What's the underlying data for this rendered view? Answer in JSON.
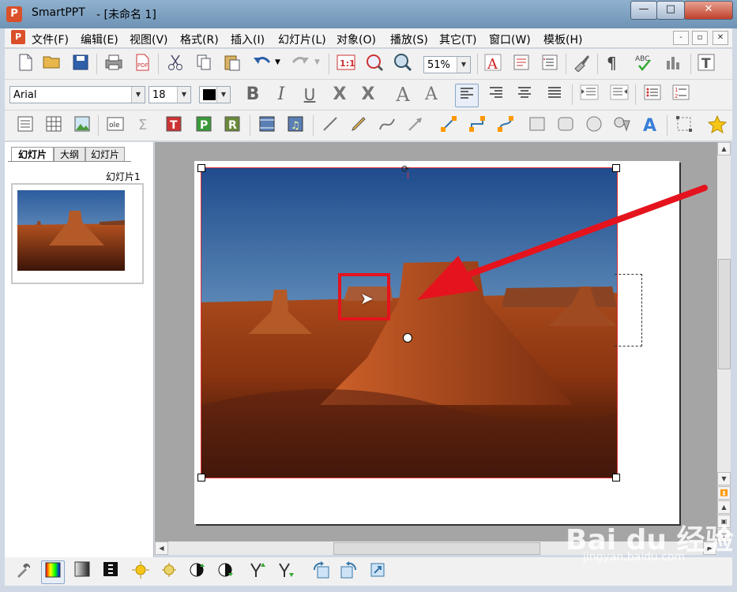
{
  "window": {
    "app_name": "SmartPPT",
    "doc_title": "- [未命名 1]",
    "app_icon_letter": "P",
    "minimize": "—",
    "maximize": "□",
    "close": "✕"
  },
  "menu": {
    "items": [
      "文件(F)",
      "编辑(E)",
      "视图(V)",
      "格式(R)",
      "插入(I)",
      "幻灯片(L)",
      "对象(O)",
      "播放(S)",
      "其它(T)",
      "窗口(W)",
      "模板(H)"
    ],
    "mdi_buttons": [
      "-",
      "▫",
      "✕"
    ]
  },
  "toolbar_standard": {
    "zoom": "51%",
    "icons": [
      "new-icon",
      "open-icon",
      "save-icon",
      "print-icon",
      "pdf-icon",
      "cut-icon",
      "copy-icon",
      "paste-icon",
      "undo-icon",
      "redo-icon",
      "actual-size-icon",
      "zoom-fit-icon",
      "zoom-icon",
      "font-color-icon",
      "format-icon",
      "list-icon",
      "brush-icon",
      "paragraph-icon",
      "spellcheck-icon",
      "chart-icon",
      "text-frame-icon"
    ]
  },
  "toolbar_format": {
    "font_name": "Arial",
    "font_size": "18",
    "color": "#000000",
    "bold": "B",
    "italic": "I",
    "underline": "U",
    "strike": "X",
    "strike2": "X",
    "grow": "A",
    "shrink": "A"
  },
  "toolbar_draw": {
    "icons": [
      "text-box-icon",
      "table-icon",
      "image-icon",
      "ole-icon",
      "formula-icon",
      "text-t-icon",
      "text-p-icon",
      "text-r-icon",
      "video-icon",
      "audio-icon",
      "line-icon",
      "pencil-icon",
      "curve-icon",
      "arrow-icon",
      "connector1-icon",
      "connector2-icon",
      "connector3-icon",
      "rectangle-icon",
      "rounded-rect-icon",
      "ellipse-icon",
      "shape-icon",
      "wordart-icon",
      "group-icon",
      "star-icon"
    ]
  },
  "left_panel": {
    "tabs": [
      "幻灯片",
      "大纲",
      "幻灯片"
    ],
    "thumb_label": "幻灯片1"
  },
  "bottom_toolbar": {
    "icons": [
      "tool-icon",
      "color-icon",
      "gradient-icon",
      "bw-icon",
      "brightness-up-icon",
      "brightness-down-icon",
      "contrast-up-icon",
      "contrast-down-icon",
      "gamma-up-icon",
      "gamma-down-icon",
      "rotate-left-icon",
      "rotate-right-icon",
      "reset-icon"
    ]
  },
  "watermark": {
    "text": "Bai du 经验",
    "sub": "jingyan.baidu.com"
  },
  "colors": {
    "highlight": "#e5131d",
    "arrow": "#e5131d",
    "selection": "#d33333"
  }
}
